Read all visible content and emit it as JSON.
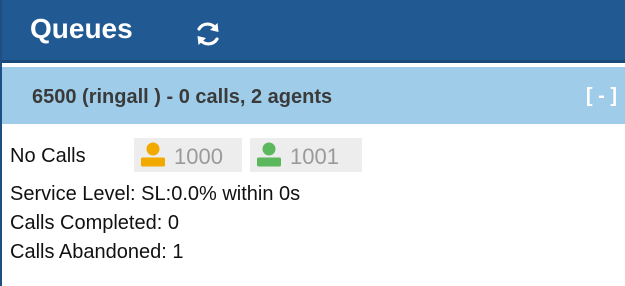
{
  "header": {
    "title": "Queues"
  },
  "queue": {
    "summary": "6500 (ringall ) - 0 calls, 2 agents",
    "toggle_label": "[ - ]",
    "status": "No Calls",
    "agents": [
      {
        "ext": "1000",
        "color": "#f2a900"
      },
      {
        "ext": "1001",
        "color": "#5cb85c"
      }
    ],
    "service_level": "Service Level: SL:0.0% within 0s",
    "calls_completed": "Calls Completed: 0",
    "calls_abandoned": "Calls Abandoned: 1"
  },
  "colors": {
    "header_bg": "#215a92",
    "queue_bar_bg": "#9fcde9"
  }
}
